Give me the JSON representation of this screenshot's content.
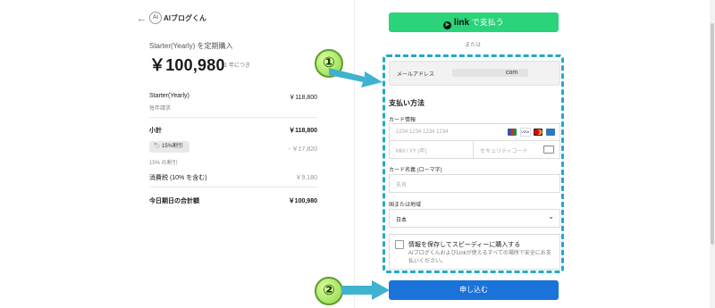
{
  "summary": {
    "back_icon": "arrow-left-icon",
    "brand_logo_text": "Ai",
    "brand_name": "AIブログくん",
    "plan_title": "Starter(Yearly) を定期購入",
    "price": "￥100,980",
    "price_unit": "1 年につき",
    "line_item": {
      "name": "Starter(Yearly)",
      "price": "￥118,800",
      "note": "毎年請求"
    },
    "subtotal": {
      "label": "小計",
      "value": "￥118,800"
    },
    "discount": {
      "badge": "15%割引",
      "amount": "- ￥17,820",
      "note": "15% の割引"
    },
    "tax": {
      "label": "消費税 (10% を含む)",
      "value": "￥9,180"
    },
    "total": {
      "label": "今日期日の合計額",
      "value": "￥100,980"
    }
  },
  "payment": {
    "link_button": {
      "brand": "link",
      "label": "で支払う"
    },
    "or_text": "または",
    "email_label": "メールアドレス",
    "email_suffix": "com",
    "section_title": "支払い方法",
    "card_info_label": "カード情報",
    "card_number_placeholder": "1234 1234 1234 1234",
    "card_brands": [
      "JCB",
      "VISA",
      "Mastercard",
      "AMEX"
    ],
    "expiry_placeholder": "MM / YY (年)",
    "cvc_placeholder": "セキュリティコード",
    "card_name_label": "カード名義 (ローマ字)",
    "card_name_placeholder": "氏名",
    "country_label": "国または地域",
    "country_value": "日本",
    "save_title": "情報を保存してスピーディーに購入する",
    "save_desc": "AIブログくんおよびLinkが使えるすべての場所で安全にお支払いください。",
    "submit_label": "申し込む"
  },
  "annotations": {
    "badge1": "①",
    "badge2": "②",
    "highlight_color": "#23a8c8",
    "badge_color": "#8ed64a"
  },
  "colors": {
    "link_green": "#2bd37a",
    "submit_blue": "#1a73d9"
  }
}
